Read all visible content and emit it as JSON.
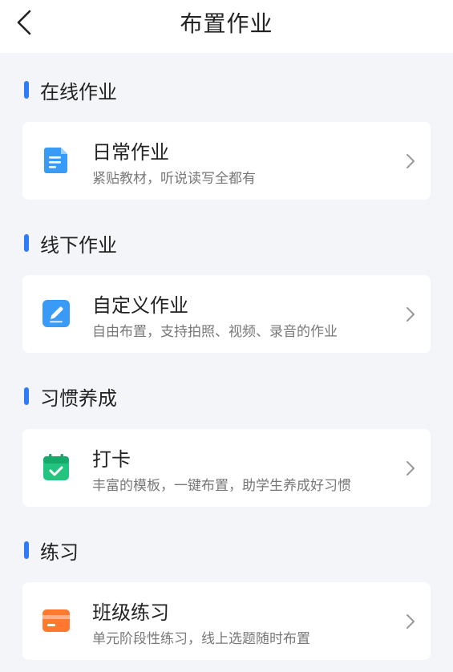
{
  "header": {
    "title": "布置作业"
  },
  "sections": [
    {
      "title": "在线作业",
      "card": {
        "title": "日常作业",
        "desc": "紧贴教材，听说读写全都有",
        "icon": "document-icon"
      }
    },
    {
      "title": "线下作业",
      "card": {
        "title": "自定义作业",
        "desc": "自由布置，支持拍照、视频、录音的作业",
        "icon": "pencil-icon"
      }
    },
    {
      "title": "习惯养成",
      "card": {
        "title": "打卡",
        "desc": "丰富的模板，一键布置，助学生养成好习惯",
        "icon": "calendar-check-icon"
      }
    },
    {
      "title": "练习",
      "card": {
        "title": "班级练习",
        "desc": "单元阶段性练习，线上选题随时布置",
        "icon": "card-icon"
      }
    }
  ],
  "colors": {
    "accent": "#2f7df6",
    "blue_icon": "#3a9bf7",
    "green_icon": "#22c47f",
    "orange_icon": "#ff7a2f"
  }
}
